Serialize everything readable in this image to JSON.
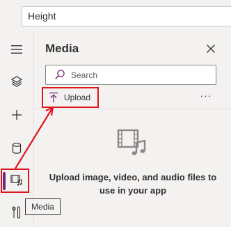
{
  "formula_bar": {
    "value": "Height"
  },
  "rail": {
    "items": [
      {
        "name": "menu",
        "icon": "hamburger-icon"
      },
      {
        "name": "tree-view",
        "icon": "layers-icon"
      },
      {
        "name": "insert",
        "icon": "plus-icon"
      },
      {
        "name": "data",
        "icon": "database-icon"
      },
      {
        "name": "media",
        "icon": "media-icon",
        "active": true
      },
      {
        "name": "tools",
        "icon": "tools-icon"
      }
    ],
    "tooltip": "Media"
  },
  "panel": {
    "title": "Media",
    "search_placeholder": "Search",
    "upload_label": "Upload",
    "more_label": "···",
    "empty_message": "Upload image, video, and audio files to use in your app"
  },
  "colors": {
    "accent": "#742774",
    "highlight": "#e0161f",
    "background": "#f3f2f1"
  }
}
